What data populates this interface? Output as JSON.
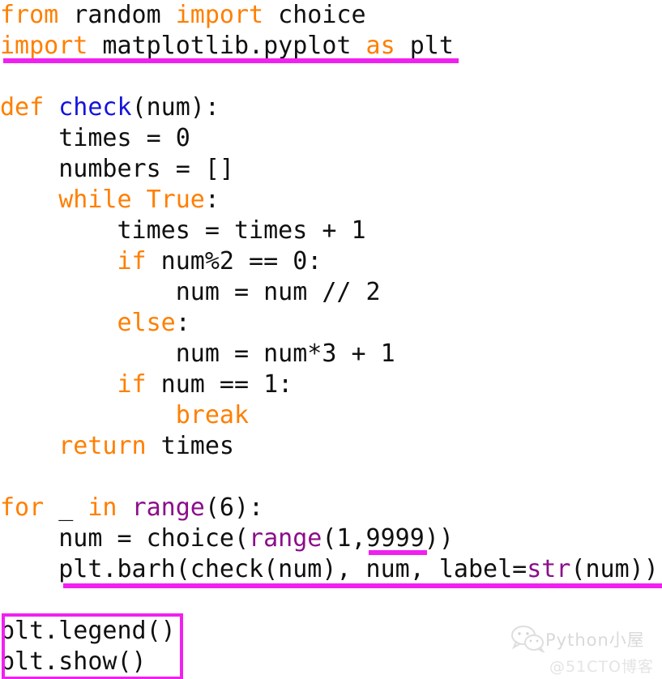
{
  "document": {
    "kind": "python-source-screenshot",
    "background_color": "#FFFFFF"
  },
  "theme": {
    "keyword_color": "#FF7F00",
    "function_name_color": "#1414DC",
    "builtin_color": "#8B0F8B",
    "plain_text_color": "#101010",
    "annotation_color": "#F020F0"
  },
  "code": {
    "lines": [
      {
        "id": "line-1",
        "tokens": [
          {
            "t": "from",
            "c": "kw"
          },
          {
            "t": " random ",
            "c": "pl"
          },
          {
            "t": "import",
            "c": "kw"
          },
          {
            "t": " choice",
            "c": "pl"
          }
        ]
      },
      {
        "id": "line-2",
        "tokens": [
          {
            "t": "import",
            "c": "kw"
          },
          {
            "t": " matplotlib.pyplot ",
            "c": "pl"
          },
          {
            "t": "as",
            "c": "kw"
          },
          {
            "t": " plt",
            "c": "pl"
          }
        ]
      },
      {
        "id": "line-3",
        "tokens": [
          {
            "t": "",
            "c": "pl"
          }
        ]
      },
      {
        "id": "line-4",
        "tokens": [
          {
            "t": "def",
            "c": "kw"
          },
          {
            "t": " ",
            "c": "pl"
          },
          {
            "t": "check",
            "c": "fn"
          },
          {
            "t": "(num):",
            "c": "pl"
          }
        ]
      },
      {
        "id": "line-5",
        "tokens": [
          {
            "t": "    times = 0",
            "c": "pl"
          }
        ]
      },
      {
        "id": "line-6",
        "tokens": [
          {
            "t": "    numbers = []",
            "c": "pl"
          }
        ]
      },
      {
        "id": "line-7",
        "tokens": [
          {
            "t": "    ",
            "c": "pl"
          },
          {
            "t": "while",
            "c": "kw"
          },
          {
            "t": " ",
            "c": "pl"
          },
          {
            "t": "True",
            "c": "kw"
          },
          {
            "t": ":",
            "c": "pl"
          }
        ]
      },
      {
        "id": "line-8",
        "tokens": [
          {
            "t": "        times = times + 1",
            "c": "pl"
          }
        ]
      },
      {
        "id": "line-9",
        "tokens": [
          {
            "t": "        ",
            "c": "pl"
          },
          {
            "t": "if",
            "c": "kw"
          },
          {
            "t": " num%2 == 0:",
            "c": "pl"
          }
        ]
      },
      {
        "id": "line-10",
        "tokens": [
          {
            "t": "            num = num // 2",
            "c": "pl"
          }
        ]
      },
      {
        "id": "line-11",
        "tokens": [
          {
            "t": "        ",
            "c": "pl"
          },
          {
            "t": "else",
            "c": "kw"
          },
          {
            "t": ":",
            "c": "pl"
          }
        ]
      },
      {
        "id": "line-12",
        "tokens": [
          {
            "t": "            num = num*3 + 1",
            "c": "pl"
          }
        ]
      },
      {
        "id": "line-13",
        "tokens": [
          {
            "t": "        ",
            "c": "pl"
          },
          {
            "t": "if",
            "c": "kw"
          },
          {
            "t": " num == 1:",
            "c": "pl"
          }
        ]
      },
      {
        "id": "line-14",
        "tokens": [
          {
            "t": "            ",
            "c": "pl"
          },
          {
            "t": "break",
            "c": "kw"
          }
        ]
      },
      {
        "id": "line-15",
        "tokens": [
          {
            "t": "    ",
            "c": "pl"
          },
          {
            "t": "return",
            "c": "kw"
          },
          {
            "t": " times",
            "c": "pl"
          }
        ]
      },
      {
        "id": "line-16",
        "tokens": [
          {
            "t": "",
            "c": "pl"
          }
        ]
      },
      {
        "id": "line-17",
        "tokens": [
          {
            "t": "for",
            "c": "kw"
          },
          {
            "t": " _ ",
            "c": "pl"
          },
          {
            "t": "in",
            "c": "kw"
          },
          {
            "t": " ",
            "c": "pl"
          },
          {
            "t": "range",
            "c": "bi"
          },
          {
            "t": "(6):",
            "c": "pl"
          }
        ]
      },
      {
        "id": "line-18",
        "tokens": [
          {
            "t": "    num = choice(",
            "c": "pl"
          },
          {
            "t": "range",
            "c": "bi"
          },
          {
            "t": "(1,9999))",
            "c": "pl"
          }
        ]
      },
      {
        "id": "line-19",
        "tokens": [
          {
            "t": "    plt.barh(check(num), num, label=",
            "c": "pl"
          },
          {
            "t": "str",
            "c": "bi"
          },
          {
            "t": "(num))",
            "c": "pl"
          }
        ]
      },
      {
        "id": "line-20",
        "tokens": [
          {
            "t": "",
            "c": "pl"
          }
        ]
      },
      {
        "id": "line-21",
        "tokens": [
          {
            "t": "plt.legend()",
            "c": "pl"
          }
        ]
      },
      {
        "id": "line-22",
        "tokens": [
          {
            "t": "plt.show()",
            "c": "pl"
          }
        ]
      }
    ],
    "plain_text": "from random import choice\nimport matplotlib.pyplot as plt\n\ndef check(num):\n    times = 0\n    numbers = []\n    while True:\n        times = times + 1\n        if num%2 == 0:\n            num = num // 2\n        else:\n            num = num*3 + 1\n        if num == 1:\n            break\n    return times\n\nfor _ in range(6):\n    num = choice(range(1,9999))\n    plt.barh(check(num), num, label=str(num))\n\nplt.legend()\nplt.show()"
  },
  "annotations": [
    {
      "id": "underline-import-line",
      "kind": "underline",
      "target_text": "import matplotlib.pyplot as plt",
      "color": "#F020F0"
    },
    {
      "id": "underline-9999",
      "kind": "underline",
      "target_text": "9999",
      "color": "#F020F0"
    },
    {
      "id": "underline-barh-line",
      "kind": "underline",
      "target_text": "plt.barh(check(num), num, label=str(num))",
      "color": "#F020F0"
    },
    {
      "id": "box-legend-show",
      "kind": "rectangle",
      "target_text": "plt.legend()\nplt.show()",
      "color": "#F020F0"
    }
  ],
  "watermark": {
    "icon_name": "wechat-icon",
    "title": "Python小屋",
    "subtitle": "@51CTO博客"
  }
}
